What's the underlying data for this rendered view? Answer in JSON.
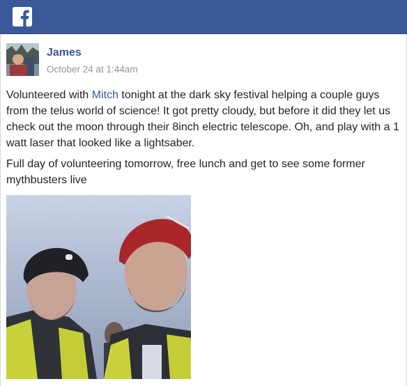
{
  "author": {
    "name": "James",
    "timestamp": "October 24 at 1:44am"
  },
  "post": {
    "text_before_mention": "Volunteered with ",
    "mention": "Mitch",
    "text_after_mention": " tonight at the dark sky festival helping a couple guys from the telus world of science! It got pretty cloudy, but before it did they let us check out the moon through their 8inch electric telescope. Oh, and play with a 1 watt laser that looked like a lightsaber.",
    "second_paragraph": "Full day of volunteering tomorrow, free lunch and get to see some former mythbusters live"
  },
  "icons": {
    "logo": "facebook-f-icon"
  },
  "colors": {
    "header": "#3b5998",
    "link": "#3b5998",
    "timestamp": "#90949c",
    "text": "#1d2129"
  }
}
